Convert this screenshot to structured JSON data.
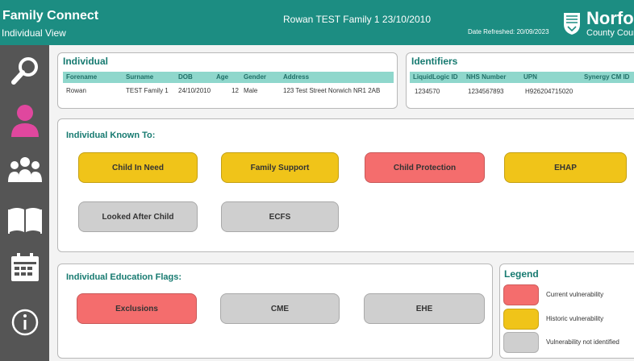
{
  "header": {
    "app_title": "Family Connect",
    "app_subtitle": "Individual View",
    "family_title": "Rowan TEST Family 1 23/10/2010",
    "refresh": "Date Refreshed: 20/09/2023",
    "logo_name": "Norfolk",
    "logo_sub": "County Council"
  },
  "sidebar": {
    "items": [
      {
        "name": "search",
        "icon": "magnifier-icon"
      },
      {
        "name": "individual",
        "icon": "person-icon",
        "active": true
      },
      {
        "name": "family",
        "icon": "group-icon"
      },
      {
        "name": "education",
        "icon": "book-icon"
      },
      {
        "name": "calendar",
        "icon": "calendar-icon"
      },
      {
        "name": "info",
        "icon": "info-icon"
      }
    ]
  },
  "individual": {
    "title": "Individual",
    "headers": [
      "Forename",
      "Surname",
      "DOB",
      "Age",
      "Gender",
      "Address"
    ],
    "row": [
      "Rowan",
      "TEST Family 1",
      "24/10/2010",
      "12",
      "Male",
      "123 Test Street Norwich NR1 2AB"
    ]
  },
  "identifiers": {
    "title": "Identifiers",
    "headers": [
      "LiquidLogic ID",
      "NHS Number",
      "UPN",
      "Synergy CM ID"
    ],
    "row": [
      "1234570",
      "1234567893",
      "H926204715020",
      ""
    ]
  },
  "known_to": {
    "title": "Individual Known To:",
    "flags": [
      {
        "label": "Child In Need",
        "status": "historic"
      },
      {
        "label": "Family Support",
        "status": "historic"
      },
      {
        "label": "Child Protection",
        "status": "current"
      },
      {
        "label": "EHAP",
        "status": "historic"
      },
      {
        "label": "Looked After Child",
        "status": "none"
      },
      {
        "label": "ECFS",
        "status": "none"
      }
    ]
  },
  "education": {
    "title": "Individual Education Flags:",
    "flags": [
      {
        "label": "Exclusions",
        "status": "current"
      },
      {
        "label": "CME",
        "status": "none"
      },
      {
        "label": "EHE",
        "status": "none"
      }
    ]
  },
  "legend": {
    "title": "Legend",
    "items": [
      {
        "label": "Current vulnerability",
        "color": "#f46d6d"
      },
      {
        "label": "Historic vulnerability",
        "color": "#f0c419"
      },
      {
        "label": "Vulnerability not identified",
        "color": "#cfcfcf"
      }
    ]
  },
  "colors": {
    "header": "#1c8d82",
    "sidebar": "#555555",
    "active_icon": "#e0479e",
    "title_text": "#167a70",
    "table_header": "#8fd7cc"
  }
}
